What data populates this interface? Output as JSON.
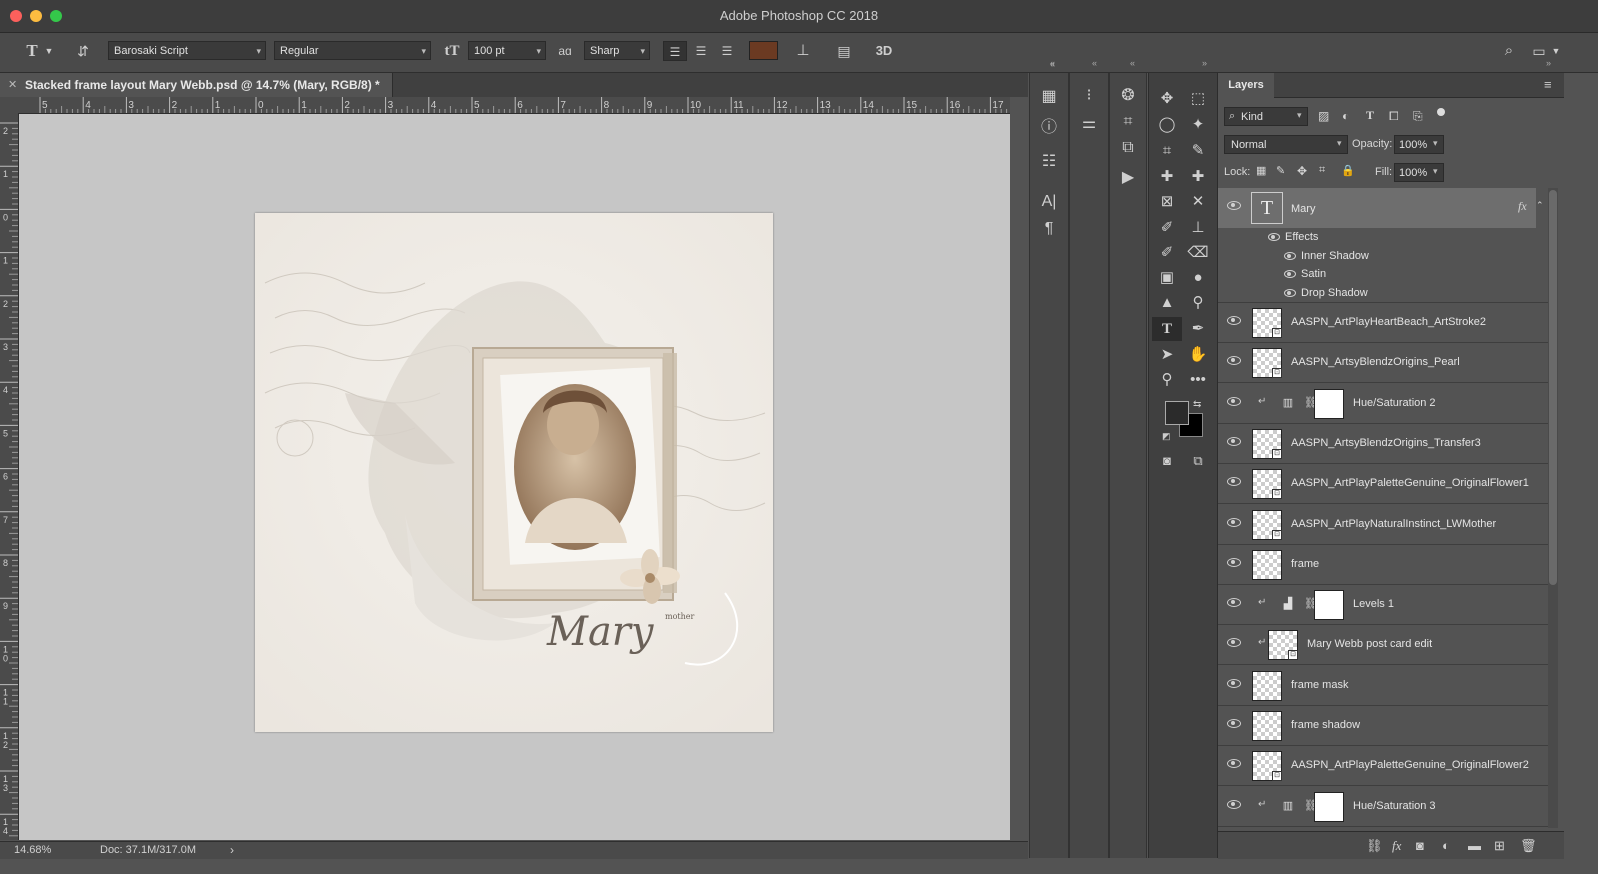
{
  "app_title": "Adobe Photoshop CC 2018",
  "options_bar": {
    "font_family": "Barosaki Script",
    "font_style": "Regular",
    "font_size": "100 pt",
    "antialias_glyph": "aɑ",
    "antialias": "Sharp",
    "three_d_label": "3D"
  },
  "document_tab": {
    "title": "Stacked frame layout Mary Webb.psd @ 14.7% (Mary, RGB/8) *"
  },
  "rulers": {
    "horizontal": [
      "5",
      "4",
      "3",
      "2",
      "1",
      "0",
      "1",
      "2",
      "3",
      "4",
      "5",
      "6",
      "7",
      "8",
      "9",
      "10",
      "11",
      "12",
      "13",
      "14",
      "15",
      "16",
      "17"
    ],
    "vertical": [
      "2",
      "1",
      "0",
      "1",
      "2",
      "3",
      "4",
      "5",
      "6",
      "7",
      "8",
      "9",
      "1\n0",
      "1\n1",
      "1\n2",
      "1\n3",
      "1\n4"
    ]
  },
  "canvas_art": {
    "script_text": "Mary",
    "small_text": "mother"
  },
  "status_bar": {
    "zoom": "14.68%",
    "doc_size": "Doc: 37.1M/317.0M"
  },
  "layers_panel": {
    "tab_label": "Layers",
    "filter_kind": "Kind",
    "blend_mode": "Normal",
    "opacity_label": "Opacity:",
    "opacity_value": "100%",
    "lock_label": "Lock:",
    "fill_label": "Fill:",
    "fill_value": "100%",
    "fx_badge": "fx",
    "type_layer": {
      "name": "Mary",
      "effects_label": "Effects",
      "effects": [
        "Inner Shadow",
        "Satin",
        "Drop Shadow"
      ]
    },
    "layers": [
      {
        "name": "AASPN_ArtPlayHeartBeach_ArtStroke2",
        "kind": "smart"
      },
      {
        "name": "AASPN_ArtsyBlendzOrigins_Pearl",
        "kind": "smart"
      },
      {
        "name": "Hue/Saturation 2",
        "kind": "adjustment",
        "icon": "hue-saturation-icon"
      },
      {
        "name": "AASPN_ArtsyBlendzOrigins_Transfer3",
        "kind": "smart"
      },
      {
        "name": "AASPN_ArtPlayPaletteGenuine_OriginalFlower1",
        "kind": "smart"
      },
      {
        "name": "AASPN_ArtPlayNaturalInstinct_LWMother",
        "kind": "smart"
      },
      {
        "name": "frame",
        "kind": "pixel"
      },
      {
        "name": "Levels 1",
        "kind": "adjustment",
        "icon": "levels-icon"
      },
      {
        "name": "Mary Webb post card edit",
        "kind": "smart-clipped"
      },
      {
        "name": "frame mask",
        "kind": "pixel"
      },
      {
        "name": "frame shadow",
        "kind": "pixel"
      },
      {
        "name": "AASPN_ArtPlayPaletteGenuine_OriginalFlower2",
        "kind": "smart"
      },
      {
        "name": "Hue/Saturation 3",
        "kind": "adjustment",
        "icon": "hue-saturation-icon"
      }
    ]
  },
  "colors": {
    "text_color_swatch": "#6b3a22",
    "foreground": "#2b2b2b",
    "background": "#000000"
  }
}
